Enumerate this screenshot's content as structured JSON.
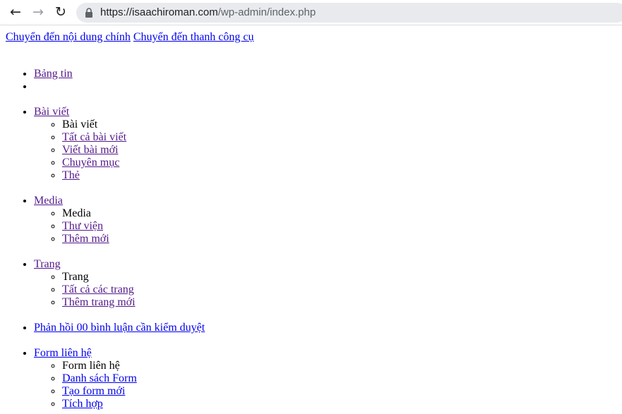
{
  "browser": {
    "url_host": "https://isaachiroman.com",
    "url_path": "/wp-admin/index.php",
    "back_icon": "arrow-left",
    "forward_icon": "arrow-right",
    "reload_icon": "reload",
    "lock_icon": "lock"
  },
  "skip_links": {
    "content": "Chuyển đến nội dung chính",
    "toolbar": "Chuyển đến thanh công cụ"
  },
  "menu": {
    "dashboard": {
      "label": "Bảng tin"
    },
    "posts": {
      "label": "Bài viết",
      "heading": "Bài viết",
      "items": [
        "Tất cả bài viết",
        "Viết bài mới",
        "Chuyên mục",
        "Thẻ"
      ]
    },
    "media": {
      "label": "Media",
      "heading": "Media",
      "items": [
        "Thư viện",
        "Thêm mới"
      ]
    },
    "pages": {
      "label": "Trang",
      "heading": "Trang",
      "items": [
        "Tất cả các trang",
        "Thêm trang mới"
      ]
    },
    "comments": {
      "label": "Phản hồi 00 bình luận cần kiểm duyệt"
    },
    "contact": {
      "label": "Form liên hệ",
      "heading": "Form liên hệ",
      "items": [
        "Danh sách Form",
        "Tạo form mới",
        "Tích hợp"
      ]
    }
  },
  "colors": {
    "link": "#0000ee",
    "visited": "#551a8b",
    "omnibox_bg": "#e8eaed"
  }
}
